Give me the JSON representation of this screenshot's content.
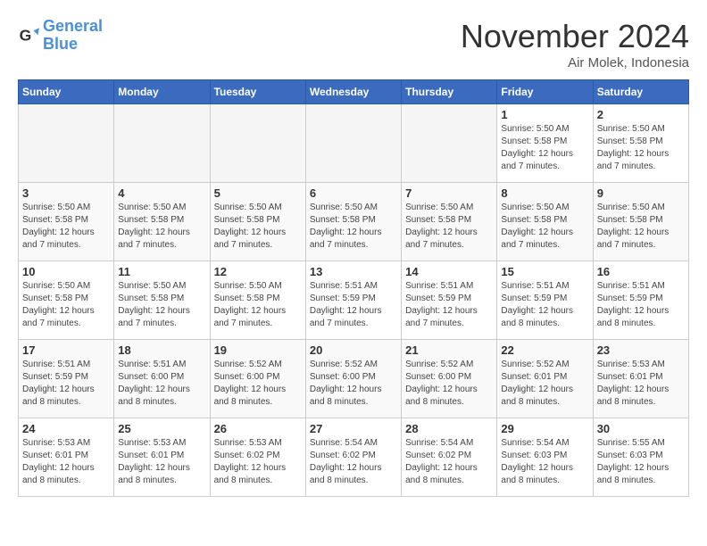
{
  "logo": {
    "line1": "General",
    "line2": "Blue"
  },
  "title": "November 2024",
  "location": "Air Molek, Indonesia",
  "days_of_week": [
    "Sunday",
    "Monday",
    "Tuesday",
    "Wednesday",
    "Thursday",
    "Friday",
    "Saturday"
  ],
  "weeks": [
    [
      {
        "num": "",
        "info": ""
      },
      {
        "num": "",
        "info": ""
      },
      {
        "num": "",
        "info": ""
      },
      {
        "num": "",
        "info": ""
      },
      {
        "num": "",
        "info": ""
      },
      {
        "num": "1",
        "info": "Sunrise: 5:50 AM\nSunset: 5:58 PM\nDaylight: 12 hours\nand 7 minutes."
      },
      {
        "num": "2",
        "info": "Sunrise: 5:50 AM\nSunset: 5:58 PM\nDaylight: 12 hours\nand 7 minutes."
      }
    ],
    [
      {
        "num": "3",
        "info": "Sunrise: 5:50 AM\nSunset: 5:58 PM\nDaylight: 12 hours\nand 7 minutes."
      },
      {
        "num": "4",
        "info": "Sunrise: 5:50 AM\nSunset: 5:58 PM\nDaylight: 12 hours\nand 7 minutes."
      },
      {
        "num": "5",
        "info": "Sunrise: 5:50 AM\nSunset: 5:58 PM\nDaylight: 12 hours\nand 7 minutes."
      },
      {
        "num": "6",
        "info": "Sunrise: 5:50 AM\nSunset: 5:58 PM\nDaylight: 12 hours\nand 7 minutes."
      },
      {
        "num": "7",
        "info": "Sunrise: 5:50 AM\nSunset: 5:58 PM\nDaylight: 12 hours\nand 7 minutes."
      },
      {
        "num": "8",
        "info": "Sunrise: 5:50 AM\nSunset: 5:58 PM\nDaylight: 12 hours\nand 7 minutes."
      },
      {
        "num": "9",
        "info": "Sunrise: 5:50 AM\nSunset: 5:58 PM\nDaylight: 12 hours\nand 7 minutes."
      }
    ],
    [
      {
        "num": "10",
        "info": "Sunrise: 5:50 AM\nSunset: 5:58 PM\nDaylight: 12 hours\nand 7 minutes."
      },
      {
        "num": "11",
        "info": "Sunrise: 5:50 AM\nSunset: 5:58 PM\nDaylight: 12 hours\nand 7 minutes."
      },
      {
        "num": "12",
        "info": "Sunrise: 5:50 AM\nSunset: 5:58 PM\nDaylight: 12 hours\nand 7 minutes."
      },
      {
        "num": "13",
        "info": "Sunrise: 5:51 AM\nSunset: 5:59 PM\nDaylight: 12 hours\nand 7 minutes."
      },
      {
        "num": "14",
        "info": "Sunrise: 5:51 AM\nSunset: 5:59 PM\nDaylight: 12 hours\nand 7 minutes."
      },
      {
        "num": "15",
        "info": "Sunrise: 5:51 AM\nSunset: 5:59 PM\nDaylight: 12 hours\nand 8 minutes."
      },
      {
        "num": "16",
        "info": "Sunrise: 5:51 AM\nSunset: 5:59 PM\nDaylight: 12 hours\nand 8 minutes."
      }
    ],
    [
      {
        "num": "17",
        "info": "Sunrise: 5:51 AM\nSunset: 5:59 PM\nDaylight: 12 hours\nand 8 minutes."
      },
      {
        "num": "18",
        "info": "Sunrise: 5:51 AM\nSunset: 6:00 PM\nDaylight: 12 hours\nand 8 minutes."
      },
      {
        "num": "19",
        "info": "Sunrise: 5:52 AM\nSunset: 6:00 PM\nDaylight: 12 hours\nand 8 minutes."
      },
      {
        "num": "20",
        "info": "Sunrise: 5:52 AM\nSunset: 6:00 PM\nDaylight: 12 hours\nand 8 minutes."
      },
      {
        "num": "21",
        "info": "Sunrise: 5:52 AM\nSunset: 6:00 PM\nDaylight: 12 hours\nand 8 minutes."
      },
      {
        "num": "22",
        "info": "Sunrise: 5:52 AM\nSunset: 6:01 PM\nDaylight: 12 hours\nand 8 minutes."
      },
      {
        "num": "23",
        "info": "Sunrise: 5:53 AM\nSunset: 6:01 PM\nDaylight: 12 hours\nand 8 minutes."
      }
    ],
    [
      {
        "num": "24",
        "info": "Sunrise: 5:53 AM\nSunset: 6:01 PM\nDaylight: 12 hours\nand 8 minutes."
      },
      {
        "num": "25",
        "info": "Sunrise: 5:53 AM\nSunset: 6:01 PM\nDaylight: 12 hours\nand 8 minutes."
      },
      {
        "num": "26",
        "info": "Sunrise: 5:53 AM\nSunset: 6:02 PM\nDaylight: 12 hours\nand 8 minutes."
      },
      {
        "num": "27",
        "info": "Sunrise: 5:54 AM\nSunset: 6:02 PM\nDaylight: 12 hours\nand 8 minutes."
      },
      {
        "num": "28",
        "info": "Sunrise: 5:54 AM\nSunset: 6:02 PM\nDaylight: 12 hours\nand 8 minutes."
      },
      {
        "num": "29",
        "info": "Sunrise: 5:54 AM\nSunset: 6:03 PM\nDaylight: 12 hours\nand 8 minutes."
      },
      {
        "num": "30",
        "info": "Sunrise: 5:55 AM\nSunset: 6:03 PM\nDaylight: 12 hours\nand 8 minutes."
      }
    ]
  ]
}
